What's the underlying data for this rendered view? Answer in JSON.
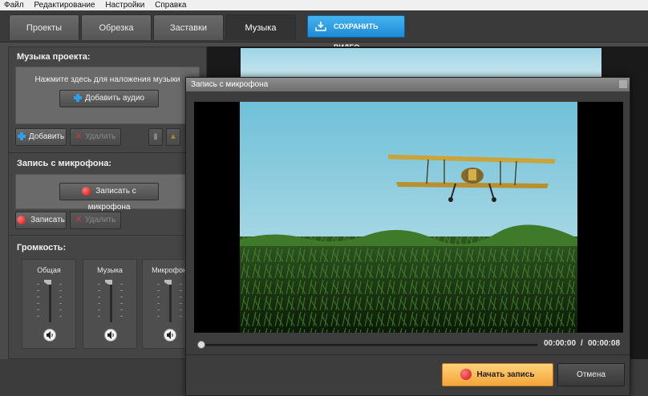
{
  "menu": [
    "Файл",
    "Редактирование",
    "Настройки",
    "Справка"
  ],
  "tabs": [
    "Проекты",
    "Обрезка",
    "Заставки",
    "Музыка"
  ],
  "active_tab": "Музыка",
  "save_video": "СОХРАНИТЬ ВИДЕО",
  "music": {
    "title": "Музыка проекта:",
    "hint": "Нажмите здесь для наложения музыки",
    "add_audio": "Добавить аудио",
    "add": "Добавить",
    "delete": "Удалить"
  },
  "mic": {
    "title": "Запись с микрофона:",
    "record_from_mic": "Записать с микрофона",
    "record": "Записать",
    "delete": "Удалить"
  },
  "volume": {
    "title": "Громкость:",
    "channels": [
      "Общая",
      "Музыка",
      "Микрофон"
    ]
  },
  "dialog": {
    "title": "Запись с микрофона",
    "time_current": "00:00:00",
    "time_separator": "/",
    "time_total": "00:00:08",
    "start_record": "Начать запись",
    "cancel": "Отмена"
  },
  "colors": {
    "accent_blue": "#1e8ad6",
    "record_orange": "#f3a43a",
    "record_red": "#d01010"
  }
}
